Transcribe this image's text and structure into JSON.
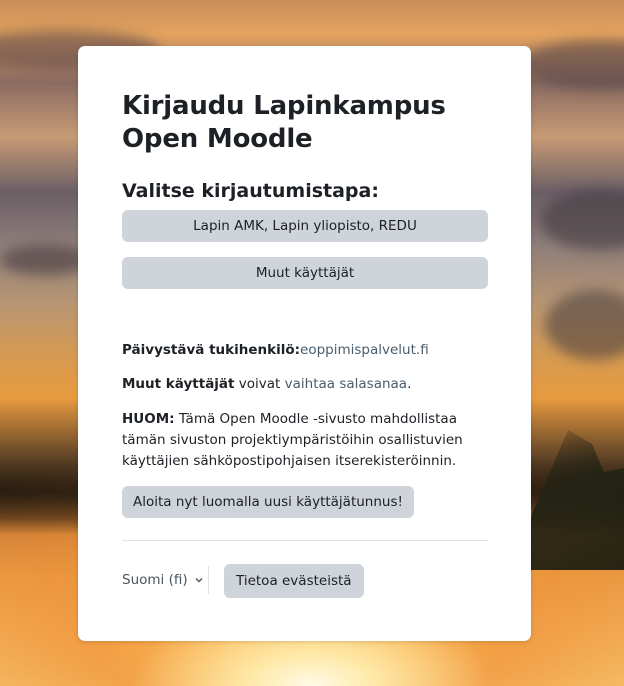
{
  "login": {
    "title": "Kirjaudu Lapinkampus Open Moodle",
    "choose_method": "Valitse kirjautumistapa:",
    "idp_buttons": [
      "Lapin AMK, Lapin yliopisto, REDU",
      "Muut käyttäjät"
    ]
  },
  "support": {
    "label": "Päivystävä tukihenkilö:",
    "link": "eoppimispalvelut.fi"
  },
  "password": {
    "bold": "Muut käyttäjät",
    "text1": " voivat ",
    "link": "vaihtaa salasanaa",
    "text2": "."
  },
  "notice": {
    "bold": "HUOM:",
    "text": " Tämä Open Moodle -sivusto mahdollistaa tämän sivuston projektiympäristöihin osallistuvien käyttäjien sähköpostipohjaisen itserekisteröinnin."
  },
  "signup_button": "Aloita nyt luomalla uusi käyttäjätunnus!",
  "footer": {
    "language": "Suomi (fi)",
    "language_icon": "chevron-down-icon",
    "cookies_button": "Tietoa evästeistä"
  },
  "colors": {
    "button_bg": "#ced4da",
    "link": "#4a5c6b",
    "card_bg": "#ffffff"
  }
}
